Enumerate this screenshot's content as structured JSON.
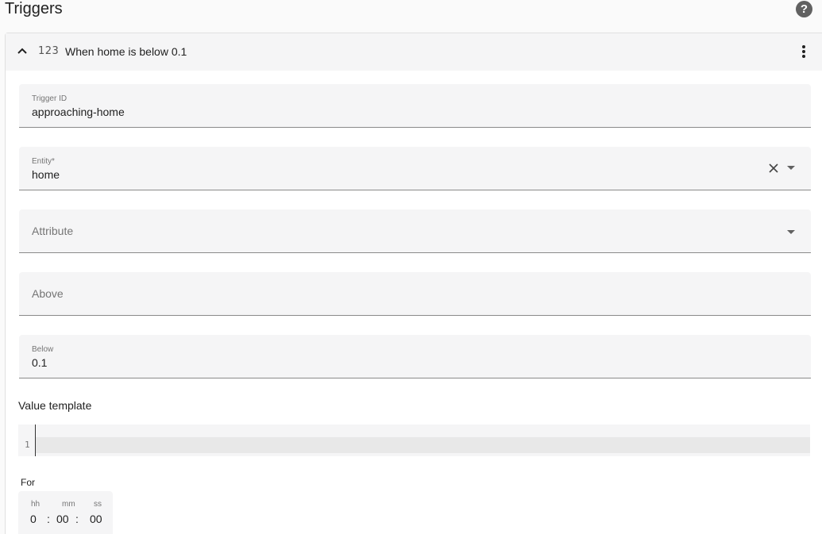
{
  "section_title": "Triggers",
  "help_glyph": "?",
  "trigger": {
    "number_icon": "123",
    "title": "When home is below 0.1"
  },
  "fields": {
    "trigger_id": {
      "label": "Trigger ID",
      "value": "approaching-home"
    },
    "entity": {
      "label": "Entity*",
      "value": "home"
    },
    "attribute": {
      "label": "Attribute"
    },
    "above": {
      "label": "Above"
    },
    "below": {
      "label": "Below",
      "value": "0.1"
    }
  },
  "value_template": {
    "label": "Value template",
    "line_number": "1"
  },
  "duration": {
    "label": "For",
    "units": {
      "hh": "hh",
      "mm": "mm",
      "ss": "ss"
    },
    "values": {
      "hours": "0",
      "minutes": "00",
      "seconds": "00"
    },
    "separator": ":"
  },
  "icons": {
    "help": "help-circle-icon",
    "collapse": "chevron-up-icon",
    "numeric": "numeric-icon",
    "menu": "dots-vertical-icon",
    "clear": "close-icon",
    "dropdown": "menu-down-icon"
  }
}
